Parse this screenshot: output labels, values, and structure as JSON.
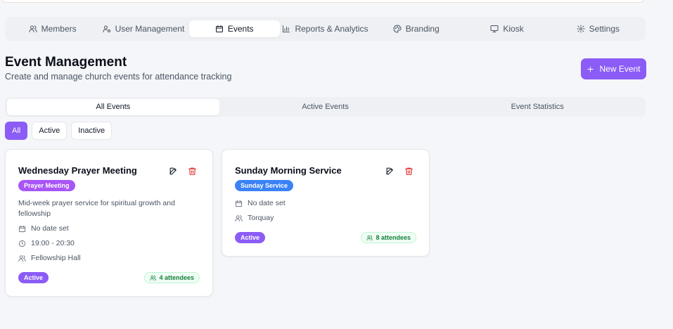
{
  "nav": {
    "tabs": [
      {
        "label": "Members",
        "icon": "users-icon"
      },
      {
        "label": "User Management",
        "icon": "user-cog-icon"
      },
      {
        "label": "Events",
        "icon": "calendar-icon",
        "active": true
      },
      {
        "label": "Reports & Analytics",
        "icon": "bar-chart-icon"
      },
      {
        "label": "Branding",
        "icon": "palette-icon"
      },
      {
        "label": "Kiosk",
        "icon": "monitor-icon"
      },
      {
        "label": "Settings",
        "icon": "gear-icon"
      }
    ]
  },
  "header": {
    "title": "Event Management",
    "subtitle": "Create and manage church events for attendance tracking",
    "new_event_label": "New Event"
  },
  "sub_tabs": [
    {
      "label": "All Events",
      "active": true
    },
    {
      "label": "Active Events"
    },
    {
      "label": "Event Statistics"
    }
  ],
  "filters": [
    {
      "label": "All",
      "active": true
    },
    {
      "label": "Active"
    },
    {
      "label": "Inactive"
    }
  ],
  "events": [
    {
      "title": "Wednesday Prayer Meeting",
      "type": "Prayer Meeting",
      "type_color": "#a855f7",
      "description": "Mid-week prayer service for spiritual growth and fellowship",
      "date": "No date set",
      "time": "19:00 - 20:30",
      "location": "Fellowship Hall",
      "status": "Active",
      "attendees": "4 attendees"
    },
    {
      "title": "Sunday Morning Service",
      "type": "Sunday Service",
      "type_color": "#3b82f6",
      "date": "No date set",
      "location": "Torquay",
      "status": "Active",
      "attendees": "8 attendees"
    }
  ],
  "colors": {
    "accent": "#8b5cf6",
    "delete": "#dc2626",
    "attendees": "#15803d"
  }
}
